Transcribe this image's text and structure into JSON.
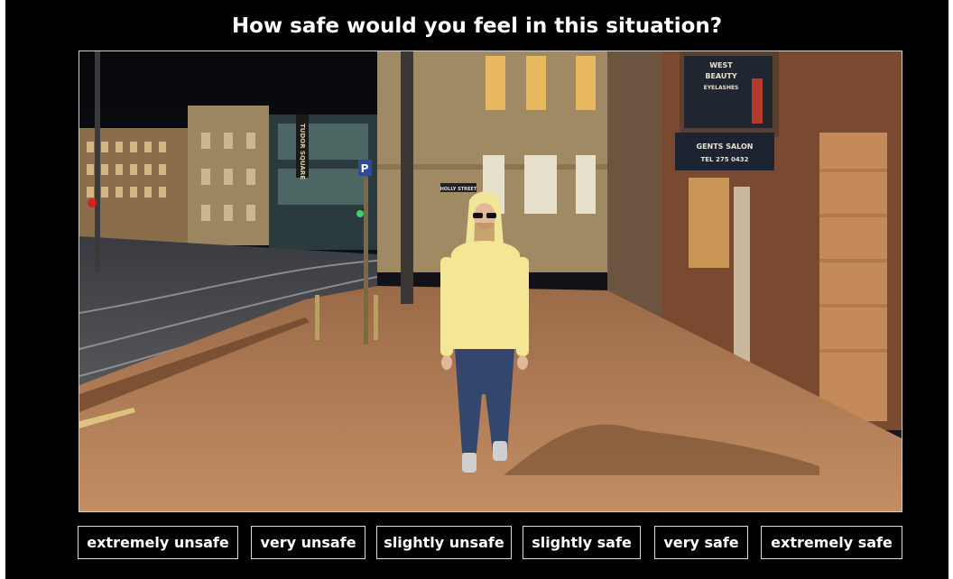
{
  "question": "How safe would you feel in this situation?",
  "scene": {
    "description_icon": "night-street-photo",
    "street_sign": "HOLLY STREET",
    "shop_sign_line1": "WEST",
    "shop_sign_line2": "BEAUTY",
    "shop_sign_line3": "EYELASHES",
    "salon_sign_line1": "GENTS SALON",
    "salon_sign_line2": "TEL 275 0432",
    "parking_sign": "P",
    "vertical_sign": "TUDOR SQUARE"
  },
  "options": [
    {
      "label": "extremely unsafe"
    },
    {
      "label": "very unsafe"
    },
    {
      "label": "slightly unsafe"
    },
    {
      "label": "slightly safe"
    },
    {
      "label": "very safe"
    },
    {
      "label": "extremely safe"
    }
  ]
}
